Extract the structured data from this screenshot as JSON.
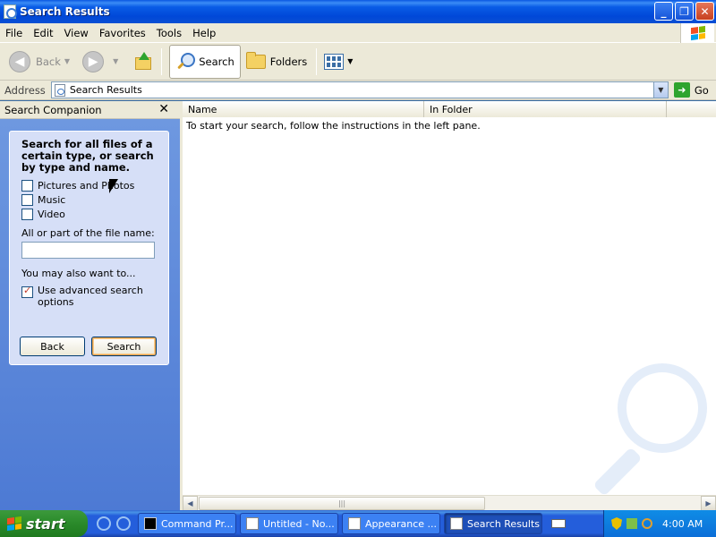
{
  "window": {
    "title": "Search Results"
  },
  "menu": [
    "File",
    "Edit",
    "View",
    "Favorites",
    "Tools",
    "Help"
  ],
  "toolbar": {
    "back": "Back",
    "search": "Search",
    "folders": "Folders"
  },
  "address": {
    "label": "Address",
    "value": "Search Results",
    "go": "Go"
  },
  "companion": {
    "title": "Search Companion",
    "heading": "Search for all files of a certain type, or search by type and name.",
    "options": [
      "Pictures and Photos",
      "Music",
      "Video"
    ],
    "filename_label": "All or part of the file name:",
    "filename_value": "",
    "also_label": "You may also want to...",
    "advanced": "Use advanced search options",
    "back_button": "Back",
    "search_button": "Search"
  },
  "results": {
    "columns": [
      "Name",
      "In Folder"
    ],
    "empty_message": "To start your search, follow the instructions in the left pane."
  },
  "taskbar": {
    "start": "start",
    "tasks": [
      "Command Pr...",
      "Untitled - No...",
      "Appearance ...",
      "Search Results"
    ],
    "clock": "4:00 AM"
  },
  "colors": {
    "titlebar": "#0a5ce6",
    "start": "#2a8a2a",
    "pane": "#6e98e0"
  }
}
